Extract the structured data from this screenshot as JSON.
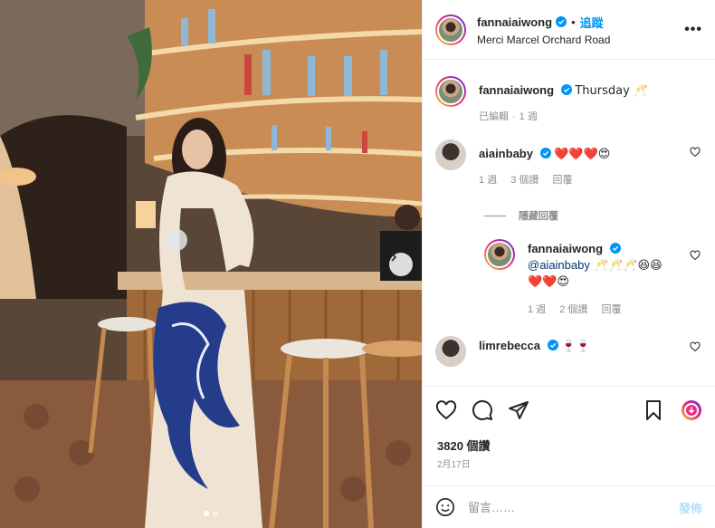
{
  "colors": {
    "accent": "#0095f6",
    "verified": "#0095f6",
    "heart": "#ed4956",
    "muted": "#8e8e8e"
  },
  "post": {
    "photo_alt": "woman in long dress at a bar",
    "carousel_count": 2,
    "carousel_active": 0
  },
  "header": {
    "username": "fannaiaiwong",
    "separator": "•",
    "follow_label": "追蹤",
    "location": "Merci Marcel Orchard Road",
    "more_label": "•••"
  },
  "caption": {
    "username": "fannaiaiwong",
    "text": "Thursday 🥂",
    "meta": {
      "edited": "已編輯",
      "dot": "·",
      "time": "1 週"
    }
  },
  "comments": [
    {
      "username": "aiainbaby",
      "text": "❤️❤️❤️😍",
      "time": "1 週",
      "likes": "3 個讚",
      "reply_label": "回覆"
    }
  ],
  "hidden_replies_label": "隱藏回覆",
  "reply": {
    "username": "fannaiaiwong",
    "mention": "@aiainbaby",
    "text": " 🥂🥂🥂😆😆",
    "text2": "❤️❤️😍",
    "time": "1 週",
    "likes": "2 個讚",
    "reply_label": "回覆"
  },
  "comment2": {
    "username": "limrebecca",
    "text": "🍷🍷"
  },
  "stats": {
    "likes": "3820 個讚",
    "date": "2月17日"
  },
  "composer": {
    "placeholder": "留言……",
    "post_label": "發佈"
  },
  "icons": [
    "heart-icon",
    "comment-icon",
    "share-icon",
    "bookmark-icon",
    "profile-ring-icon",
    "emoji-icon",
    "chevron-right-icon",
    "verified-icon"
  ]
}
